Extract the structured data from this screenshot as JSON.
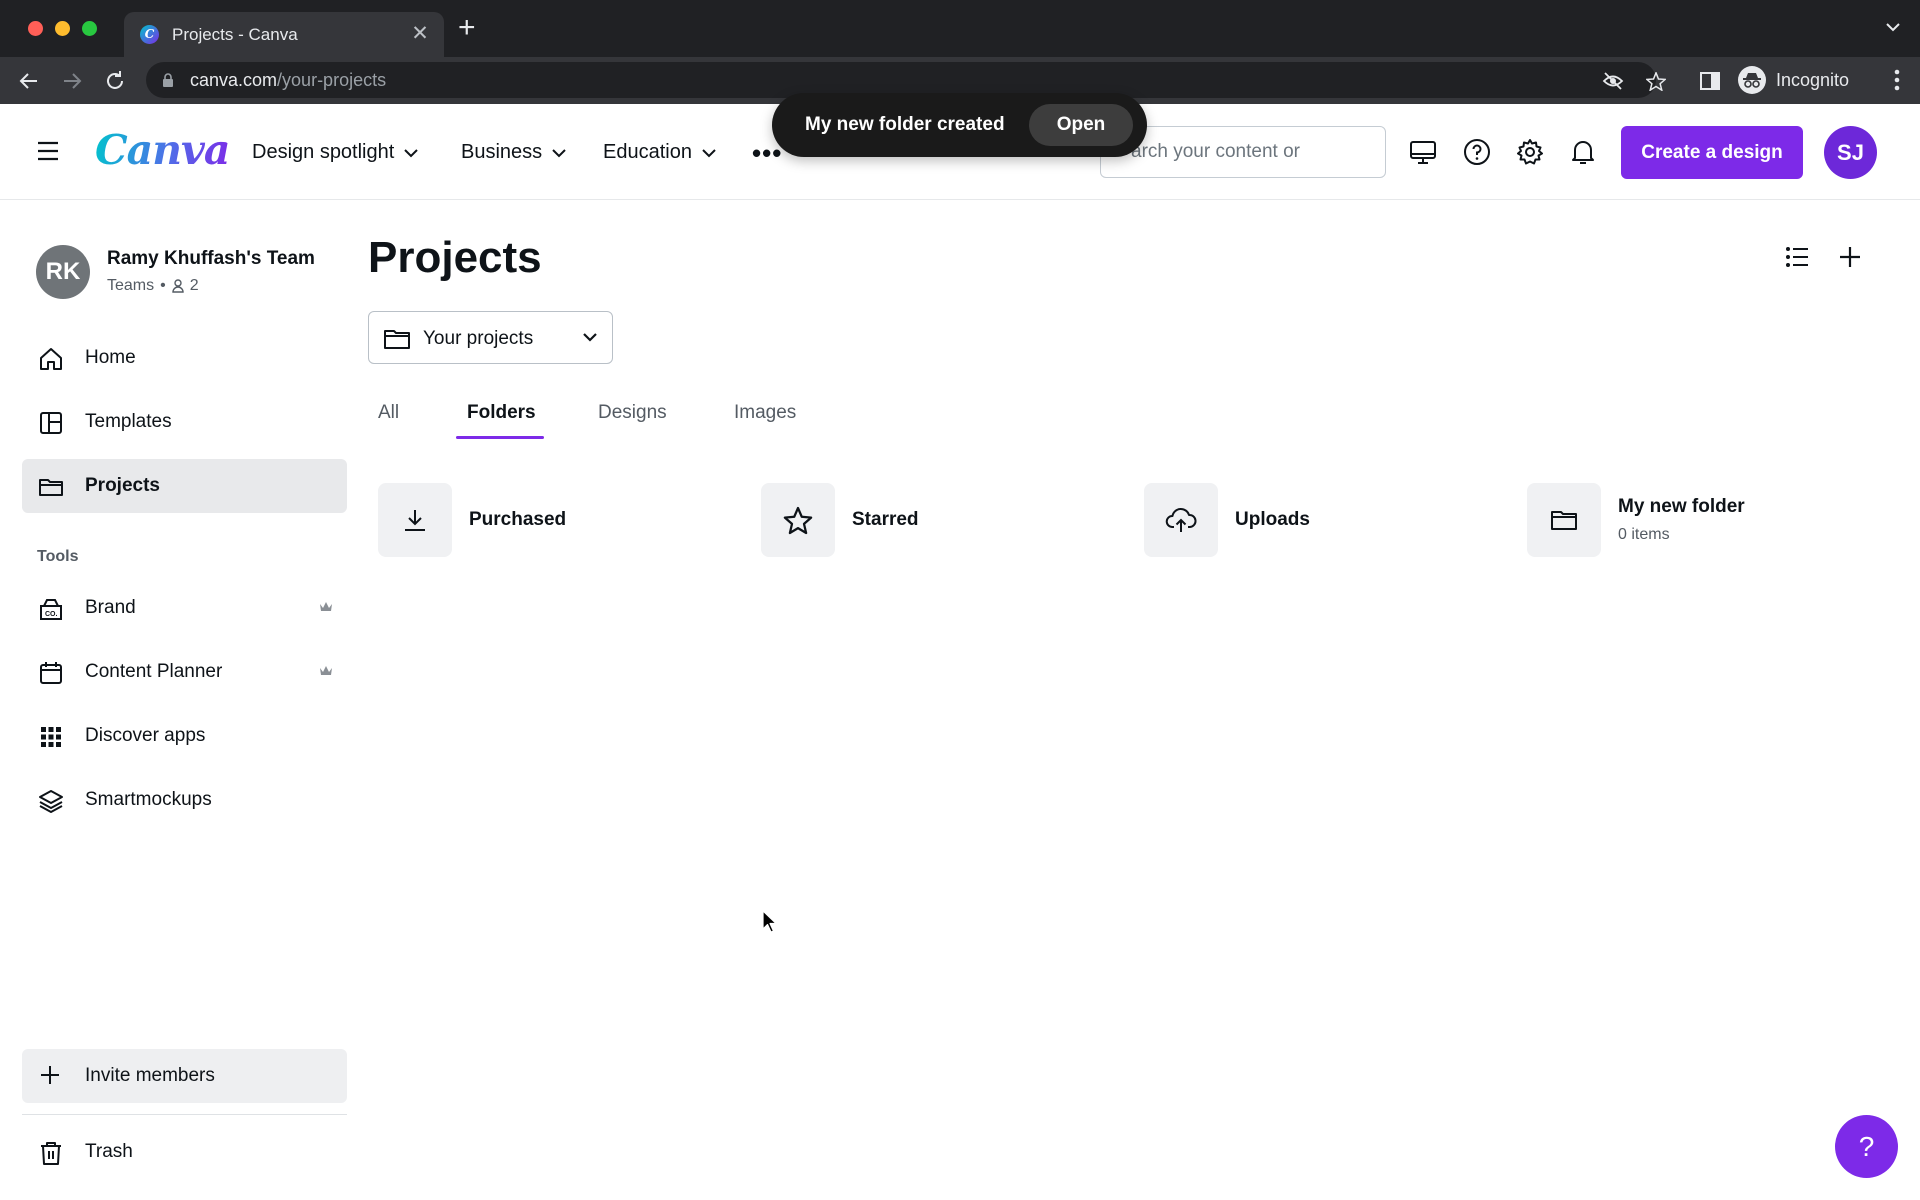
{
  "browser": {
    "tab_title": "Projects - Canva",
    "url_domain": "canva.com",
    "url_path": "/your-projects",
    "profile_label": "Incognito"
  },
  "header": {
    "logo": "Canva",
    "nav": [
      {
        "label": "Design spotlight"
      },
      {
        "label": "Business"
      },
      {
        "label": "Education"
      }
    ],
    "search_text": "arch your content or",
    "create_button": "Create a design",
    "avatar_initials": "SJ"
  },
  "toast": {
    "message": "My new folder created",
    "action": "Open"
  },
  "sidebar": {
    "team_initials": "RK",
    "team_name": "Ramy Khuffash's Team",
    "team_type": "Teams",
    "team_separator": "•",
    "member_count": "2",
    "nav": [
      {
        "label": "Home",
        "icon": "home-icon"
      },
      {
        "label": "Templates",
        "icon": "templates-icon"
      },
      {
        "label": "Projects",
        "icon": "folder-icon",
        "active": true
      }
    ],
    "tools_heading": "Tools",
    "tools": [
      {
        "label": "Brand",
        "icon": "brand-icon",
        "premium": true
      },
      {
        "label": "Content Planner",
        "icon": "calendar-icon",
        "premium": true
      },
      {
        "label": "Discover apps",
        "icon": "apps-grid-icon"
      },
      {
        "label": "Smartmockups",
        "icon": "layers-icon"
      }
    ],
    "invite_label": "Invite members",
    "trash_label": "Trash"
  },
  "main": {
    "title": "Projects",
    "dropdown_label": "Your projects",
    "tabs": [
      {
        "label": "All"
      },
      {
        "label": "Folders",
        "active": true
      },
      {
        "label": "Designs"
      },
      {
        "label": "Images"
      }
    ],
    "folders": [
      {
        "name": "Purchased",
        "icon": "download-icon"
      },
      {
        "name": "Starred",
        "icon": "star-icon"
      },
      {
        "name": "Uploads",
        "icon": "cloud-upload-icon"
      },
      {
        "name": "My new folder",
        "count": "0 items",
        "icon": "folder-icon"
      }
    ]
  },
  "help_fab": "?",
  "colors": {
    "accent": "#7d2ae8",
    "chrome_dark": "#202124",
    "chrome_toolbar": "#35363a"
  }
}
